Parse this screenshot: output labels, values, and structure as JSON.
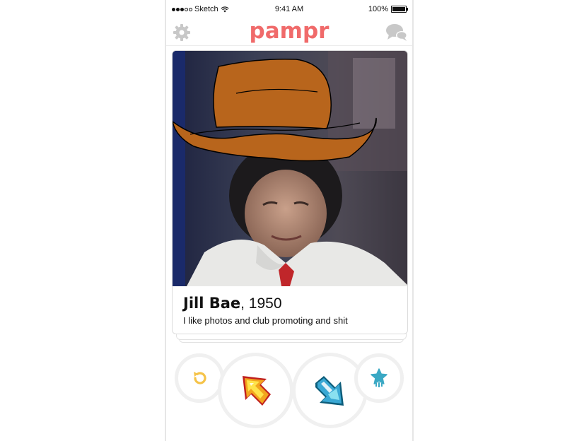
{
  "status_bar": {
    "carrier": "Sketch",
    "time": "9:41 AM",
    "battery": "100%"
  },
  "nav": {
    "logo": "pampr",
    "left_icon": "gear-icon",
    "right_icon": "chat-bubbles-icon"
  },
  "profile": {
    "name": "Jill Bae",
    "year": ", 1950",
    "bio": "I like photos and club promoting and shit"
  },
  "actions": {
    "undo_icon": "undo-icon",
    "nope_icon": "arrow-up-left-icon",
    "like_icon": "arrow-down-right-icon",
    "super_icon": "star-icon"
  },
  "colors": {
    "brand": "#f06a6a",
    "undo": "#f5c348",
    "super": "#3aa8c4",
    "icon_gray": "#c8c8c8"
  }
}
